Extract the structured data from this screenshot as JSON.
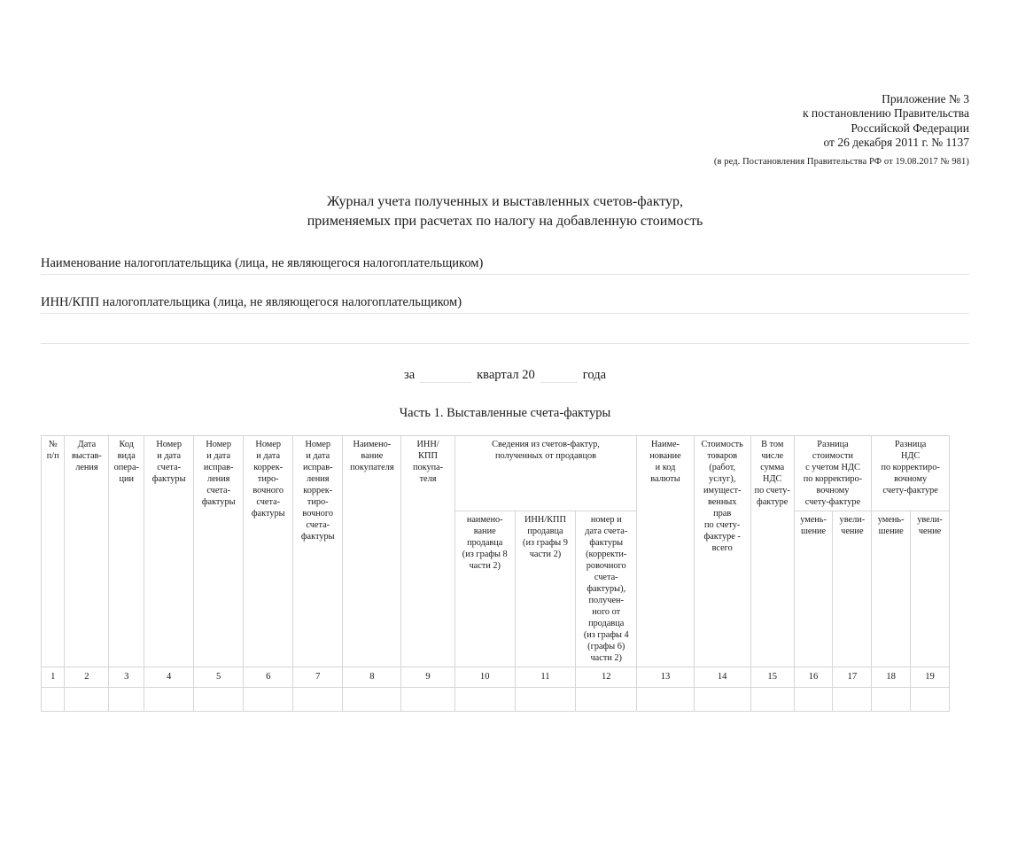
{
  "reference": {
    "lines": [
      "Приложение № 3",
      "к постановлению Правительства",
      "Российской Федерации",
      "от 26 декабря 2011 г. № 1137"
    ],
    "amendment_note": "(в ред. Постановления Правительства РФ от 19.08.2017 № 981)"
  },
  "title": {
    "line1": "Журнал учета полученных и выставленных счетов-фактур,",
    "line2": "применяемых при расчетах по налогу на добавленную стоимость"
  },
  "fields": [
    {
      "label": "Наименование налогоплательщика (лица, не являющегося налогоплательщиком)",
      "value": ""
    },
    {
      "label": "ИНН/КПП налогоплательщика (лица, не являющегося налогоплательщиком)",
      "value": ""
    }
  ],
  "period": {
    "prefix": "за",
    "middle": "квартал 20",
    "suffix": "года",
    "quarter_value": "",
    "year_value": ""
  },
  "part_title": "Часть 1. Выставленные счета-фактуры",
  "table": {
    "columns": [
      {
        "num": "1",
        "header": "№\nп/п"
      },
      {
        "num": "2",
        "header": "Дата\nвыстав-\nления"
      },
      {
        "num": "3",
        "header": "Код\nвида\nопера-\nции"
      },
      {
        "num": "4",
        "header": "Номер\nи дата\nсчета-\nфактуры"
      },
      {
        "num": "5",
        "header": "Номер\nи дата\nисправ-\nления\nсчета-\nфактуры"
      },
      {
        "num": "6",
        "header": "Номер\nи дата\nкоррек-\nтиро-\nвочного\nсчета-\nфактуры"
      },
      {
        "num": "7",
        "header": "Номер\nи дата\nисправ-\nления\nкоррек-\nтиро-\nвочного\nсчета-\nфактуры"
      },
      {
        "num": "8",
        "header": "Наимено-\nвание\nпокупателя"
      },
      {
        "num": "9",
        "header": "ИНН/\nКПП\nпокупа-\nтеля"
      },
      {
        "num": "10",
        "header": "наимено-\nвание\nпродавца\n(из графы 8\nчасти 2)"
      },
      {
        "num": "11",
        "header": "ИНН/КПП\nпродавца\n(из графы 9\nчасти 2)"
      },
      {
        "num": "12",
        "header": "номер и\nдата счета-\nфактуры\n(корректи-\nровочного\nсчета-\nфактуры),\nполучен-\nного от\nпродавца\n(из графы 4\n(графы 6)\nчасти 2)"
      },
      {
        "num": "13",
        "header": "Наиме-\nнование\nи код\nвалюты"
      },
      {
        "num": "14",
        "header": "Стоимость\nтоваров\n(работ,\nуслуг),\nимущест-\nвенных\nправ\nпо счету-\nфактуре -\nвсего"
      },
      {
        "num": "15",
        "header": "В том\nчисле\nсумма\nНДС\nпо счету-\nфактуре"
      },
      {
        "num": "16",
        "header": "умень-\nшение"
      },
      {
        "num": "17",
        "header": "увели-\nчение"
      },
      {
        "num": "18",
        "header": "умень-\nшение"
      },
      {
        "num": "19",
        "header": "увели-\nчение"
      }
    ],
    "groups": {
      "sellers_info": "Сведения из счетов-фактур,\nполученных от продавцов",
      "diff_cost": "Разница\nстоимости\nс учетом НДС\nпо корректиро-\nвочному\nсчету-фактуре",
      "diff_vat": "Разница\nНДС\nпо корректиро-\nвочному\nсчету-фактуре"
    },
    "empty_row_cells": [
      "",
      "",
      "",
      "",
      "",
      "",
      "",
      "",
      "",
      "",
      "",
      "",
      "",
      "",
      "",
      "",
      "",
      "",
      ""
    ]
  },
  "colors": {
    "border": "#d6d6d6",
    "rule": "#e3e3e3",
    "text": "#1a1a1a"
  }
}
